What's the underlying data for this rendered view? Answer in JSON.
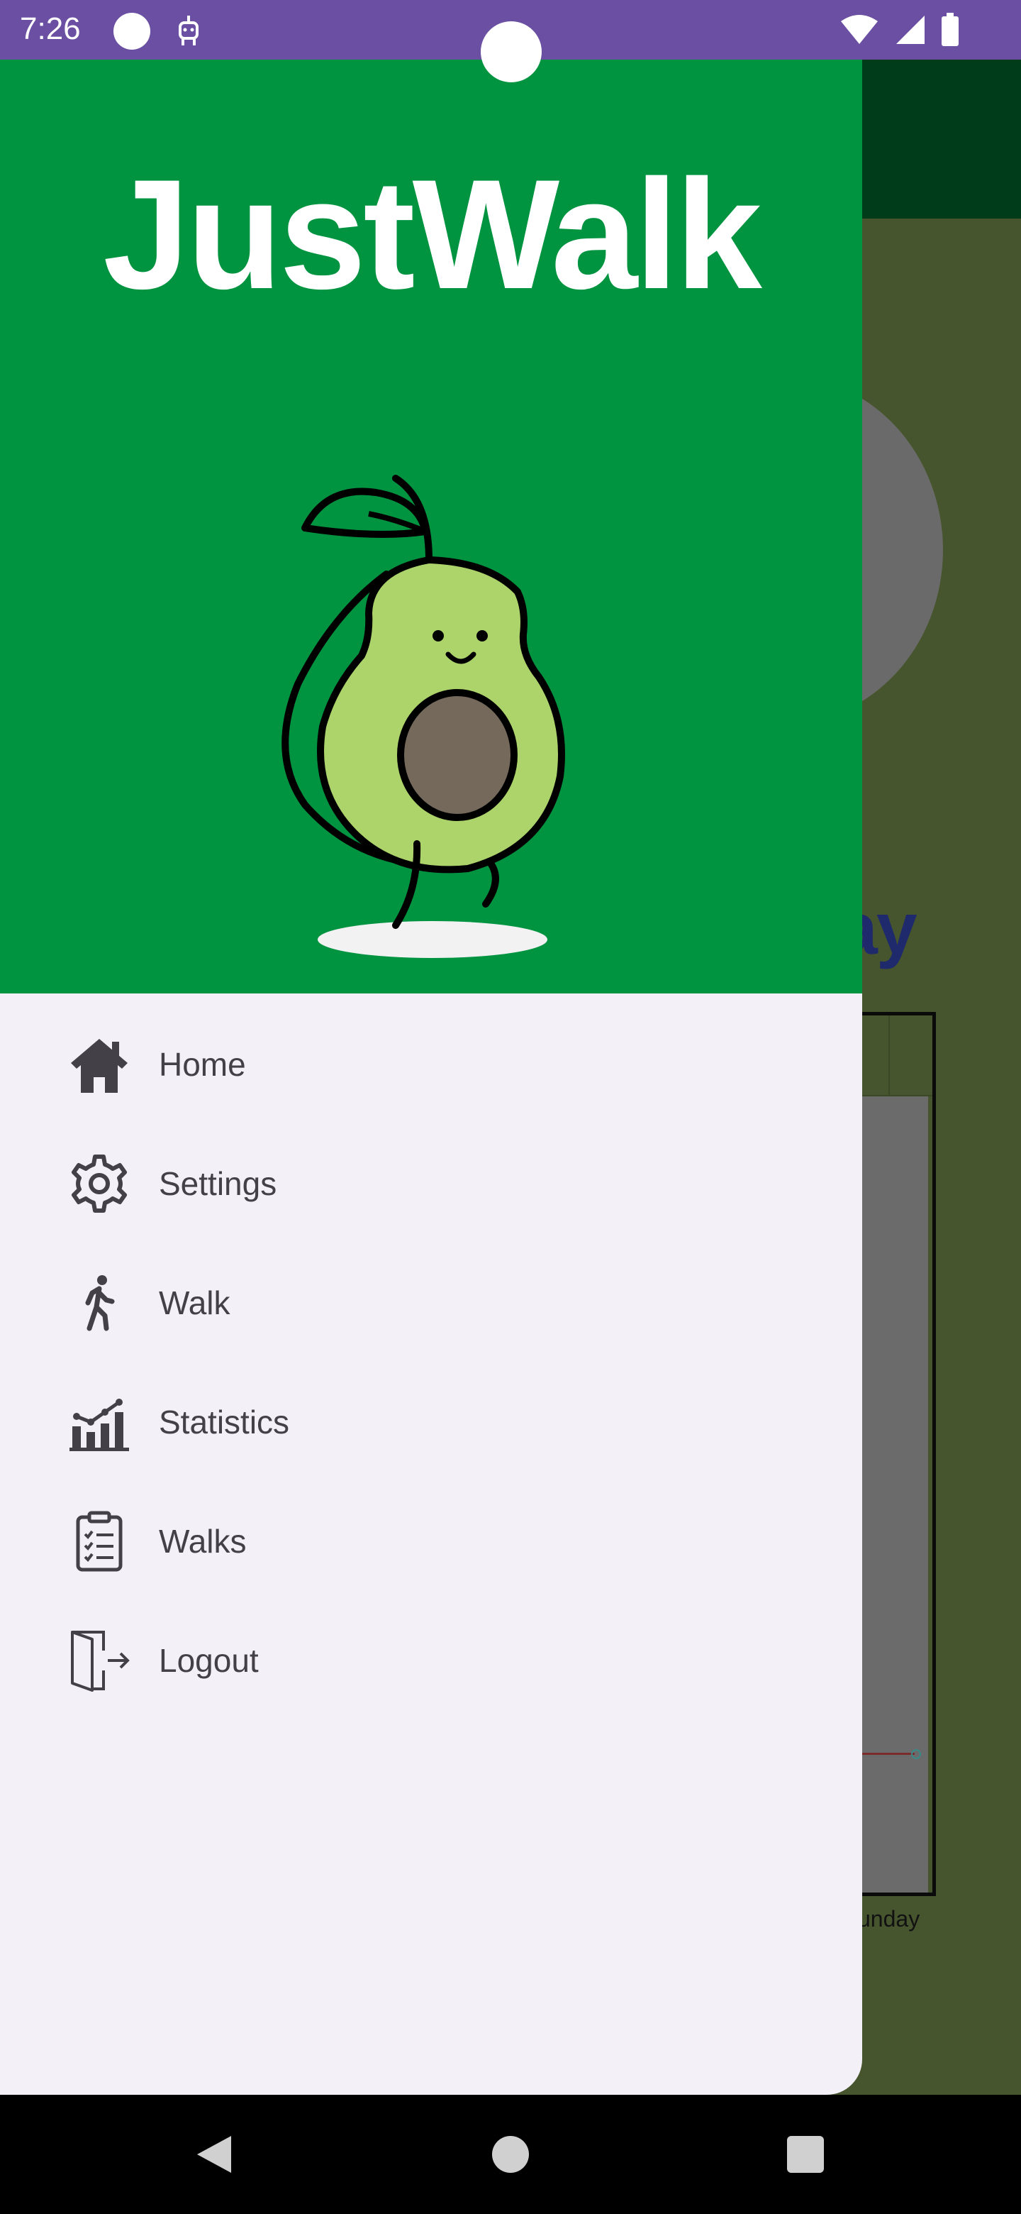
{
  "status_bar": {
    "time": "7:26"
  },
  "drawer": {
    "title": "JustWalk",
    "items": [
      {
        "label": "Home",
        "icon": "home-icon"
      },
      {
        "label": "Settings",
        "icon": "gear-icon"
      },
      {
        "label": "Walk",
        "icon": "walking-person-icon"
      },
      {
        "label": "Statistics",
        "icon": "bar-chart-icon"
      },
      {
        "label": "Walks",
        "icon": "clipboard-list-icon"
      },
      {
        "label": "Logout",
        "icon": "logout-door-icon"
      }
    ]
  },
  "background_app": {
    "title_fragment": "ay",
    "chart_xlabel_fragment": "unday"
  },
  "colors": {
    "status_bar": "#6a4fa3",
    "drawer_header": "#009440",
    "drawer_body": "#f4f0f7",
    "menu_text": "#444048",
    "scrim": "#46552d"
  }
}
